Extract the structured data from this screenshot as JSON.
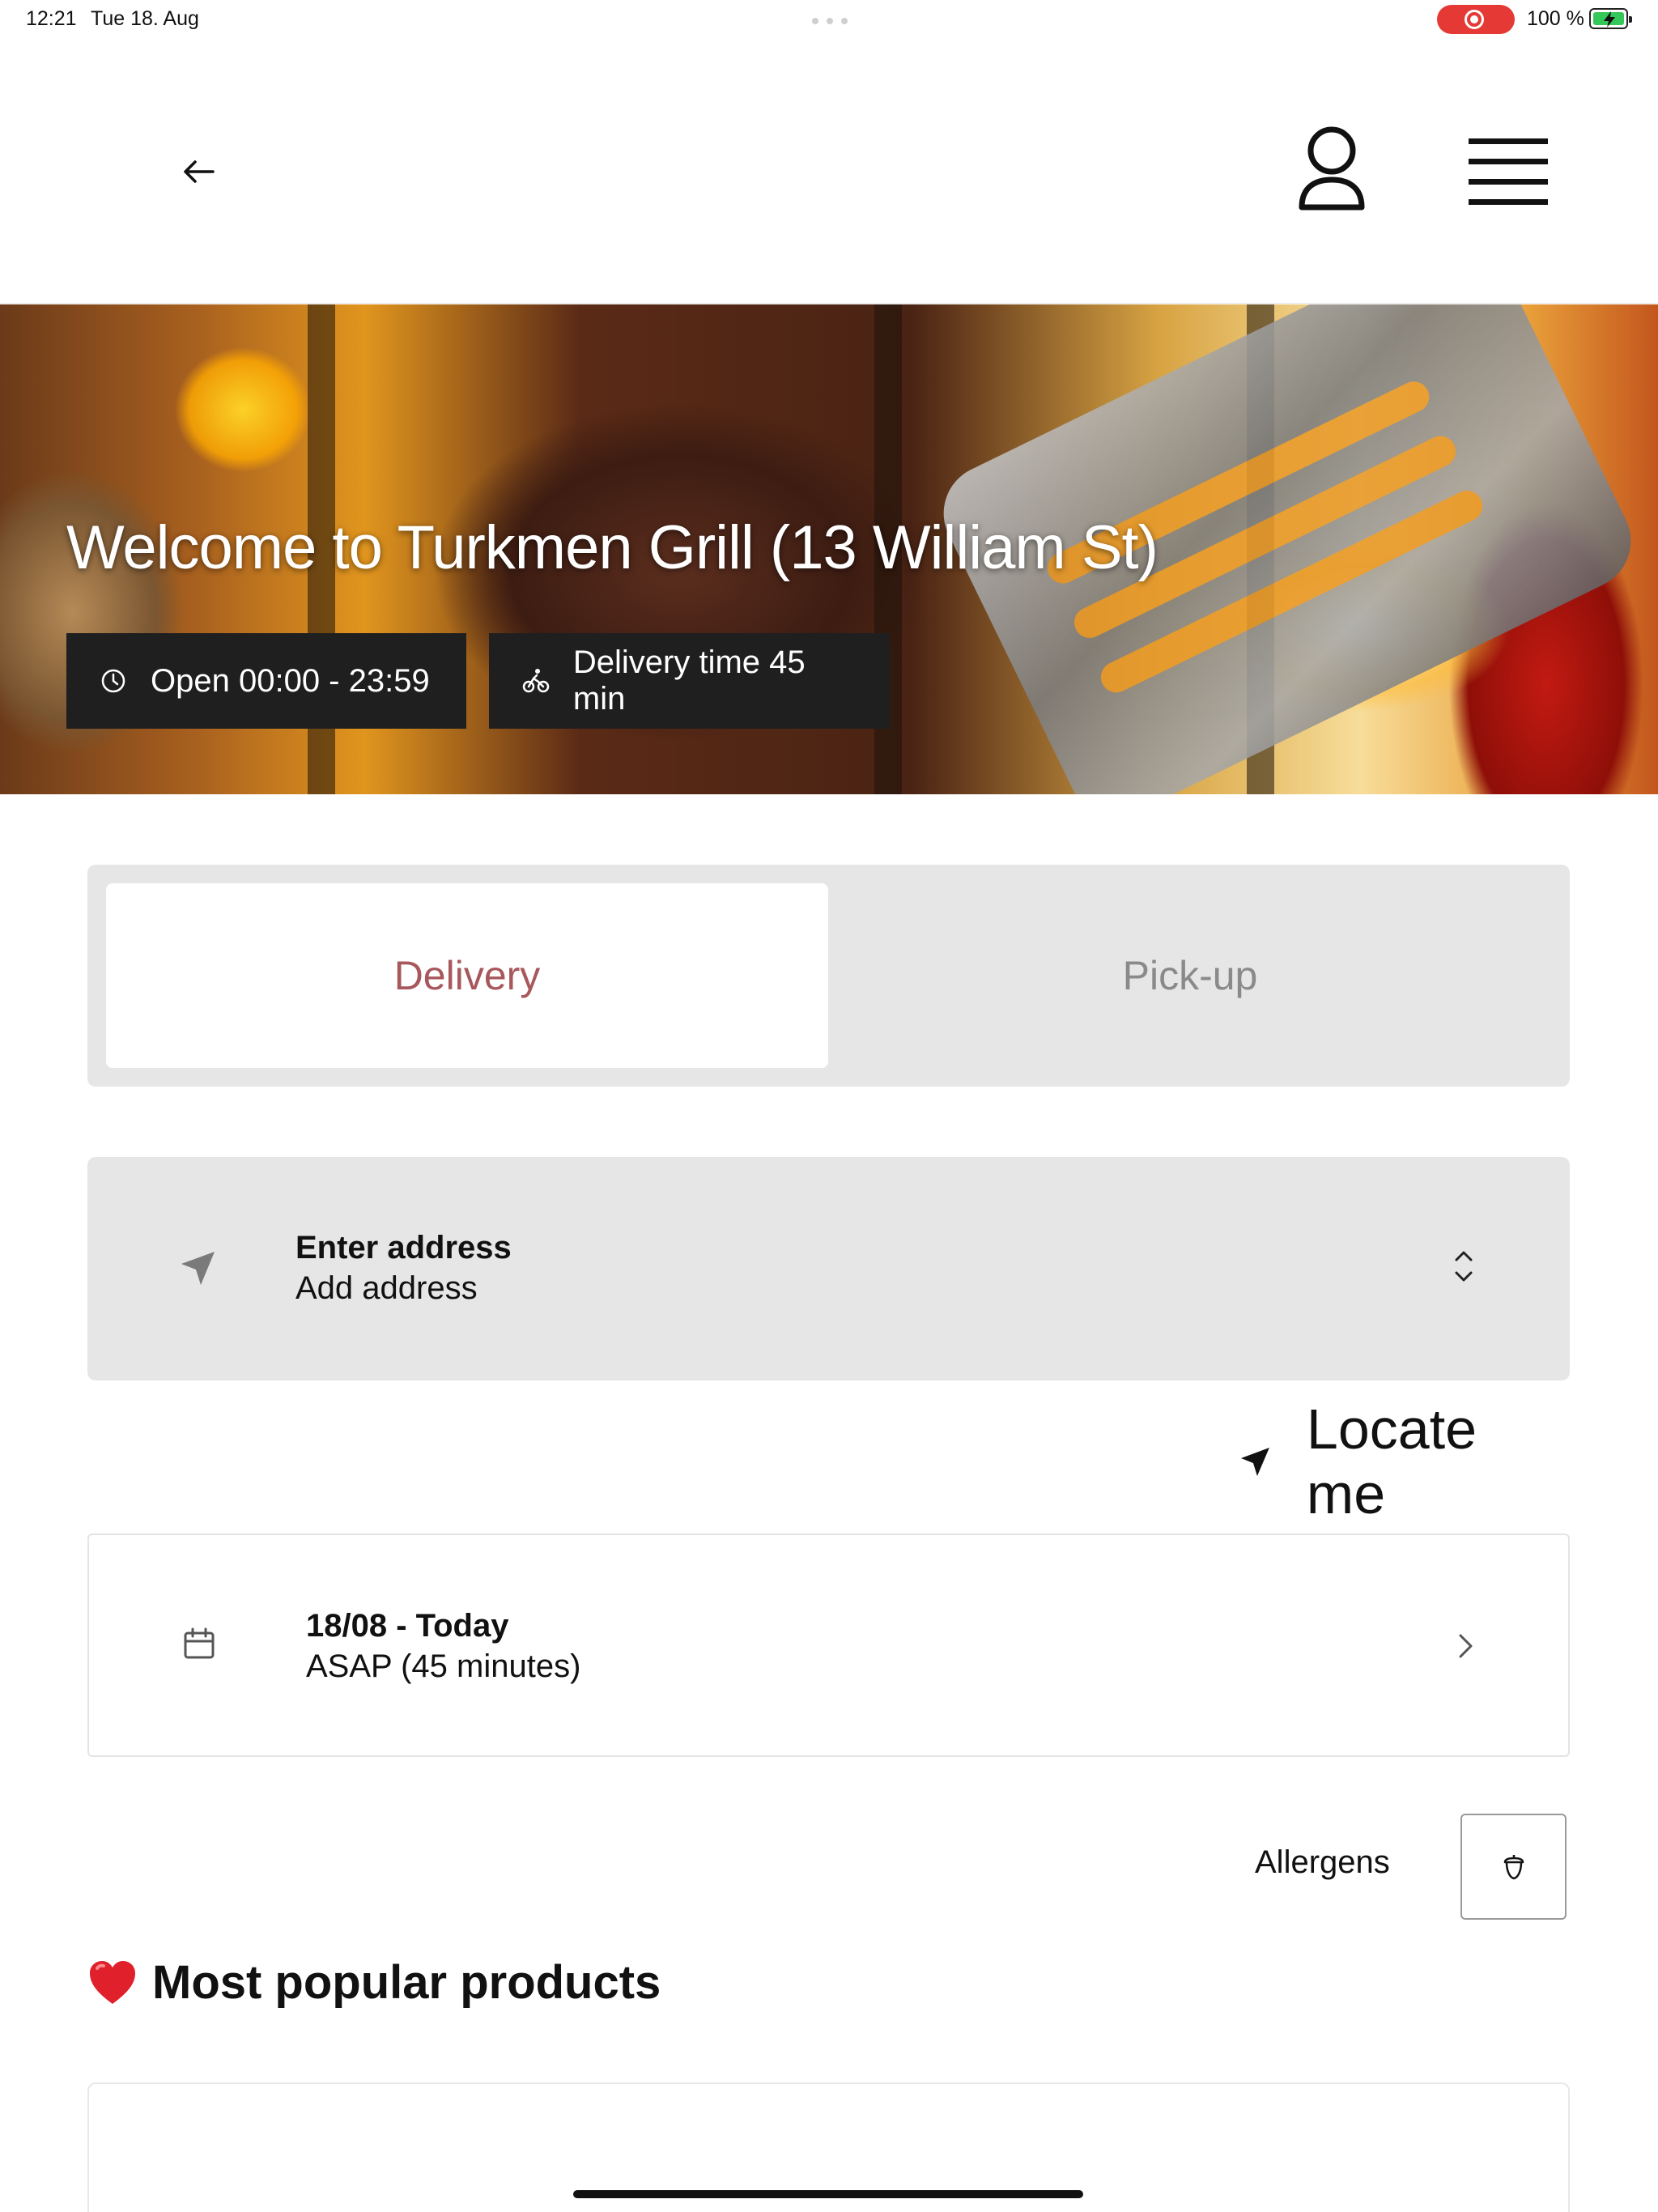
{
  "status_bar": {
    "time": "12:21",
    "date": "Tue 18. Aug",
    "battery_percent": "100 %",
    "battery_level": 1.0,
    "recording_indicator_color": "#e53935"
  },
  "header": {
    "back_icon": "arrow-left-icon",
    "profile_icon": "user-icon",
    "menu_icon": "hamburger-menu-icon"
  },
  "hero": {
    "title": "Welcome to Turkmen Grill (13 William St)",
    "open_hours": "Open 00:00 - 23:59",
    "delivery_time": "Delivery time 45 min",
    "open_icon": "clock-icon",
    "delivery_icon": "bicycle-icon"
  },
  "order_type": {
    "options": [
      "Delivery",
      "Pick-up"
    ],
    "selected": "Delivery",
    "accent_color": "#a8585c"
  },
  "address": {
    "title": "Enter address",
    "subtitle": "Add address",
    "icon": "navigation-arrow-icon"
  },
  "locate": {
    "label": "Locate me"
  },
  "time_slot": {
    "title": "18/08 - Today",
    "subtitle": "ASAP (45 minutes)",
    "icon": "calendar-icon"
  },
  "allergens": {
    "label": "Allergens",
    "icon": "acorn-icon"
  },
  "popular": {
    "heading": "Most popular products",
    "heading_icon": "heart-icon"
  }
}
